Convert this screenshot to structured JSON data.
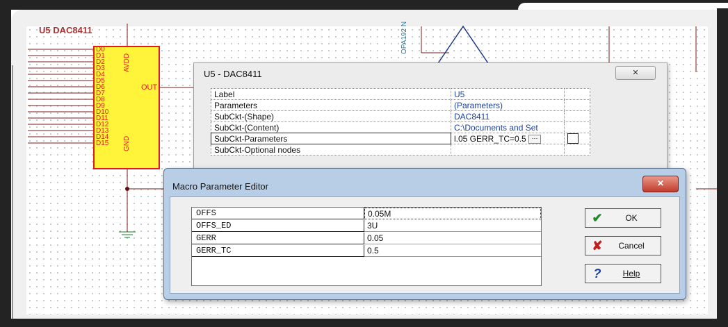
{
  "schematic": {
    "component_ref": "U5 DAC8411",
    "pins_left": [
      "D0",
      "D1",
      "D2",
      "D3",
      "D4",
      "D5",
      "D6",
      "D7",
      "D8",
      "D9",
      "D10",
      "D11",
      "D12",
      "D13",
      "D14",
      "D15"
    ],
    "pin_avdd": "AVDD",
    "pin_gnd": "GND",
    "pin_out": "OUT",
    "opamp_label": "OPA192 N"
  },
  "properties_dialog": {
    "title": "U5 - DAC8411",
    "close_glyph": "✕",
    "rows": [
      {
        "name": "Label",
        "value": "U5"
      },
      {
        "name": "Parameters",
        "value": "(Parameters)"
      },
      {
        "name": "SubCkt-(Shape)",
        "value": "DAC8411"
      },
      {
        "name": "SubCkt-(Content)",
        "value": "C:\\Documents and Set"
      },
      {
        "name": "SubCkt-Parameters",
        "value": "l.05 GERR_TC=0.5"
      },
      {
        "name": "SubCkt-Optional nodes",
        "value": ""
      }
    ],
    "browse_label": "···"
  },
  "macro_editor": {
    "title": "Macro Parameter Editor",
    "close_glyph": "✕",
    "params": [
      {
        "name": "OFFS",
        "value": "0.05M"
      },
      {
        "name": "OFFS_ED",
        "value": "3U"
      },
      {
        "name": "GERR",
        "value": "0.05"
      },
      {
        "name": "GERR_TC",
        "value": "0.5"
      }
    ],
    "ok_label": "OK",
    "cancel_label": "Cancel",
    "help_label": "Help",
    "ok_icon": "✔",
    "cancel_icon": "✘",
    "help_icon": "?"
  },
  "colors": {
    "pin_red": "#e01c1c",
    "chip_yellow": "#fff43a",
    "link_blue": "#1c3fa0"
  }
}
